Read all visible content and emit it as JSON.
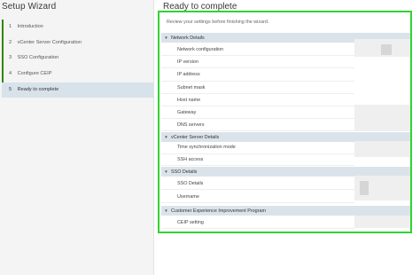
{
  "wizard": {
    "title": "Setup Wizard",
    "steps": [
      {
        "num": "1",
        "label": "Introduction"
      },
      {
        "num": "2",
        "label": "vCenter Server Configuration"
      },
      {
        "num": "3",
        "label": "SSO Configuration"
      },
      {
        "num": "4",
        "label": "Configure CEIP"
      },
      {
        "num": "5",
        "label": "Ready to complete"
      }
    ]
  },
  "page": {
    "title": "Ready to complete",
    "intro": "Review your settings before finishing the wizard."
  },
  "sections": [
    {
      "label": "Network Details",
      "rows": [
        "Network configuration",
        "IP version",
        "IP address",
        "Subnet mask",
        "Host name",
        "Gateway",
        "DNS servers"
      ]
    },
    {
      "label": "vCenter Server Details",
      "rows": [
        "Time synchronization mode",
        "SSH access"
      ]
    },
    {
      "label": "SSO Details",
      "rows": [
        "SSO Details",
        "Username"
      ]
    },
    {
      "label": "Customer Experience Improvement Program",
      "rows": [
        "CEIP setting"
      ]
    }
  ],
  "colors": {
    "highlight_border": "#32d232",
    "active_step_bg": "#d8e2ea",
    "section_header_bg": "#dbe3ea",
    "step_bar": "#318700"
  }
}
